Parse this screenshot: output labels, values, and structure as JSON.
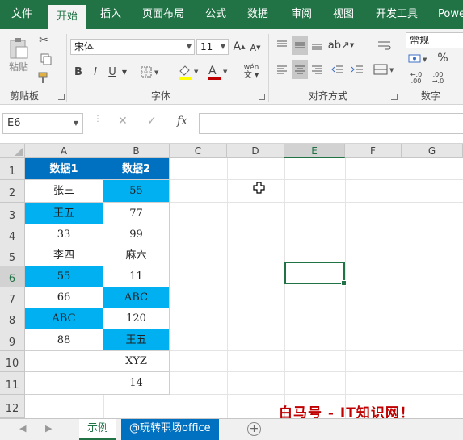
{
  "ribbon_tabs": [
    "文件",
    "开始",
    "插入",
    "页面布局",
    "公式",
    "数据",
    "审阅",
    "视图",
    "开发工具",
    "Powe"
  ],
  "ribbon": {
    "clipboard": {
      "paste_label": "粘贴",
      "group_label": "剪贴板"
    },
    "font": {
      "font_name": "宋体",
      "font_size": "11",
      "bold": "B",
      "italic": "I",
      "underline": "U",
      "font_color_label": "A",
      "grow_font": "A",
      "shrink_font": "A",
      "phonetic": "wén",
      "group_label": "字体"
    },
    "alignment": {
      "group_label": "对齐方式"
    },
    "number": {
      "format": "常规",
      "percent": "%",
      "group_label": "数字"
    }
  },
  "formula_bar": {
    "name_box": "E6",
    "cancel": "✕",
    "enter": "✓",
    "fx": "fx",
    "value": ""
  },
  "columns": [
    "A",
    "B",
    "C",
    "D",
    "E",
    "F",
    "G"
  ],
  "rows": [
    "1",
    "2",
    "3",
    "4",
    "5",
    "6",
    "7",
    "8",
    "9",
    "10",
    "11",
    "12"
  ],
  "table": {
    "headers": [
      "数据1",
      "数据2"
    ],
    "col_a": [
      "张三",
      "王五",
      "33",
      "李四",
      "55",
      "66",
      "ABC",
      "88",
      "",
      ""
    ],
    "col_b": [
      "55",
      "77",
      "99",
      "麻六",
      "11",
      "ABC",
      "120",
      "王五",
      "XYZ",
      "14"
    ],
    "highlight_a": [
      false,
      true,
      false,
      false,
      true,
      false,
      true,
      false,
      false,
      false
    ],
    "highlight_b": [
      true,
      false,
      false,
      false,
      false,
      true,
      false,
      true,
      false,
      false
    ]
  },
  "active_cell": "E6",
  "sheet_tabs": [
    "示例",
    "@玩转职场office"
  ],
  "watermark": "白马号 - IT知识网！",
  "colors": {
    "excel_green": "#217346",
    "header_blue": "#0070c0",
    "highlight_cyan": "#00b0f0"
  }
}
